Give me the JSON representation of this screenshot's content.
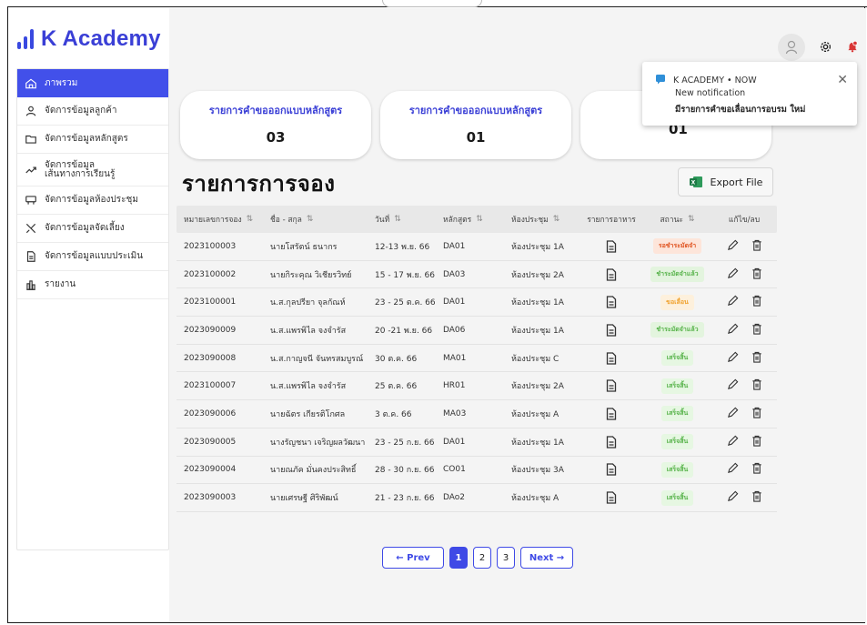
{
  "app": {
    "logo_text": "K Academy",
    "accent": "#3a3fd6"
  },
  "sidebar": {
    "items": [
      {
        "label": "ภาพรวม",
        "icon": "home-icon"
      },
      {
        "label": "จัดการข้อมูลลูกค้า",
        "icon": "user-icon"
      },
      {
        "label": "จัดการข้อมูลหลักสูตร",
        "icon": "folder-icon"
      },
      {
        "label": "จัดการข้อมูล\nเส้นทางการเรียนรู้",
        "icon": "trend-icon"
      },
      {
        "label": "จัดการข้อมูลห้องประชุม",
        "icon": "meeting-room-icon"
      },
      {
        "label": "จัดการข้อมูลจัดเลี้ยง",
        "icon": "catering-icon"
      },
      {
        "label": "จัดการข้อมูลแบบประเมิน",
        "icon": "form-icon"
      },
      {
        "label": "รายงาน",
        "icon": "report-icon"
      }
    ]
  },
  "stats": [
    {
      "title": "รายการคำขอออกแบบหลักสูตร",
      "value": "03"
    },
    {
      "title": "รายการคำขอออกแบบหลักสูตร",
      "value": "01"
    },
    {
      "title": "",
      "value": "01"
    }
  ],
  "notification": {
    "source": "K ACADEMY • NOW",
    "subtitle": "New notification",
    "message": "มีรายการคำขอเลื่อนการอบรม ใหม่"
  },
  "page": {
    "title": "รายการการจอง",
    "export_label": "Export File"
  },
  "table": {
    "headers": [
      "หมายเลขการจอง",
      "ชื่อ - สกุล",
      "วันที่",
      "หลักสูตร",
      "ห้องประชุม",
      "รายการอาหาร",
      "สถานะ",
      "แก้ไข/ลบ"
    ],
    "rows": [
      {
        "id": "2023100003",
        "name": "นายโสรัตน์ ธนากร",
        "date": "12-13 พ.ย. 66",
        "course": "DA01",
        "room": "ห้องประชุม 1A",
        "status": "รอชำระมัดจำ",
        "status_type": "warn"
      },
      {
        "id": "2023100002",
        "name": "นายกิระคุณ วิเชียรวิทย์",
        "date": "15 - 17 พ.ย. 66",
        "course": "DA03",
        "room": "ห้องประชุม 2A",
        "status": "ชำระมัดจำแล้ว",
        "status_type": "paid"
      },
      {
        "id": "2023100001",
        "name": "น.ส.กุลปรียา จุลกัณห์",
        "date": "23 - 25 ต.ค. 66",
        "course": "DA01",
        "room": "ห้องประชุม 1A",
        "status": "ขอเลื่อน",
        "status_type": "pend"
      },
      {
        "id": "2023090009",
        "name": "น.ส.แพรพิไล จงจำรัส",
        "date": "20 -21 พ.ย. 66",
        "course": "DA06",
        "room": "ห้องประชุม 1A",
        "status": "ชำระมัดจำแล้ว",
        "status_type": "paid"
      },
      {
        "id": "2023090008",
        "name": "น.ส.กาญจนี จันทรสมบูรณ์",
        "date": "30 ต.ค. 66",
        "course": "MA01",
        "room": "ห้องประชุม C",
        "status": "เสร็จสิ้น",
        "status_type": "done"
      },
      {
        "id": "2023100007",
        "name": "น.ส.แพรพิไล จงจำรัส",
        "date": "25 ต.ค. 66",
        "course": "HR01",
        "room": "ห้องประชุม 2A",
        "status": "เสร็จสิ้น",
        "status_type": "done"
      },
      {
        "id": "2023090006",
        "name": "นายฉัตร เกียรติโกศล",
        "date": "3 ต.ค. 66",
        "course": "MA03",
        "room": "ห้องประชุม A",
        "status": "เสร็จสิ้น",
        "status_type": "done"
      },
      {
        "id": "2023090005",
        "name": "นางรัญชนา เจริญผลวัฒนา",
        "date": "23 - 25 ก.ย. 66",
        "course": "DA01",
        "room": "ห้องประชุม 1A",
        "status": "เสร็จสิ้น",
        "status_type": "done"
      },
      {
        "id": "2023090004",
        "name": "นายณภัค มั่นคงประสิทธิ์",
        "date": "28 - 30 ก.ย. 66",
        "course": "CO01",
        "room": "ห้องประชุม 3A",
        "status": "เสร็จสิ้น",
        "status_type": "done"
      },
      {
        "id": "2023090003",
        "name": "นายเศรษฐี ศิริพัฒน์",
        "date": "21 - 23 ก.ย. 66",
        "course": "DAo2",
        "room": "ห้องประชุม A",
        "status": "เสร็จสิ้น",
        "status_type": "done"
      }
    ]
  },
  "pagination": {
    "prev": "← Prev",
    "pages": [
      "1",
      "2",
      "3"
    ],
    "current": "1",
    "next": "Next →"
  },
  "colors": {
    "primary": "#4250ea",
    "badge_warn": "#e0531f",
    "badge_ok": "#57b34a",
    "badge_pending": "#f0a22e",
    "notif_bell": "#d93636"
  }
}
